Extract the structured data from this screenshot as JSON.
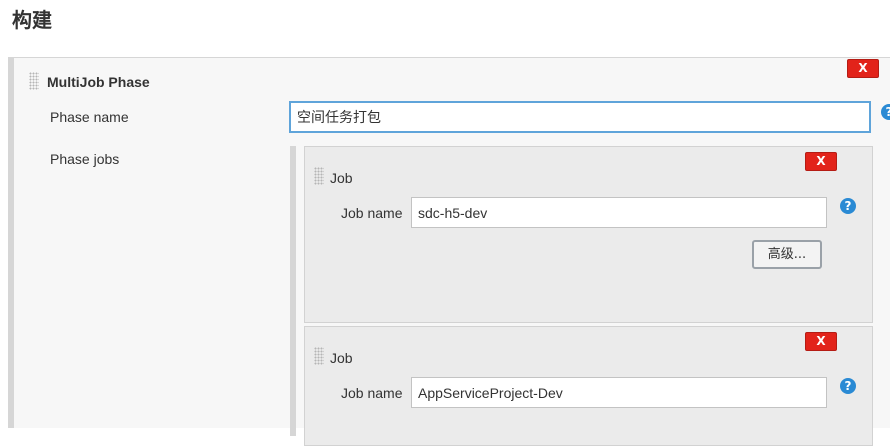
{
  "section": {
    "title": "构建"
  },
  "phase": {
    "heading": "MultiJob Phase",
    "delete_label": "X",
    "name_label": "Phase name",
    "name_value": "空间任务打包",
    "jobs_label": "Phase jobs",
    "help_label": "?"
  },
  "jobs": [
    {
      "title": "Job",
      "delete_label": "X",
      "name_label": "Job name",
      "name_value": "sdc-h5-dev",
      "help_label": "?",
      "advanced_label": "高级..."
    },
    {
      "title": "Job",
      "delete_label": "X",
      "name_label": "Job name",
      "name_value": "AppServiceProject-Dev",
      "help_label": "?"
    }
  ],
  "colors": {
    "delete_button": "#e2231a",
    "help_icon": "#2a8ad4",
    "focus_border": "#5fa4da",
    "panel_background": "#f7f7f7",
    "job_background": "#ebebeb"
  }
}
